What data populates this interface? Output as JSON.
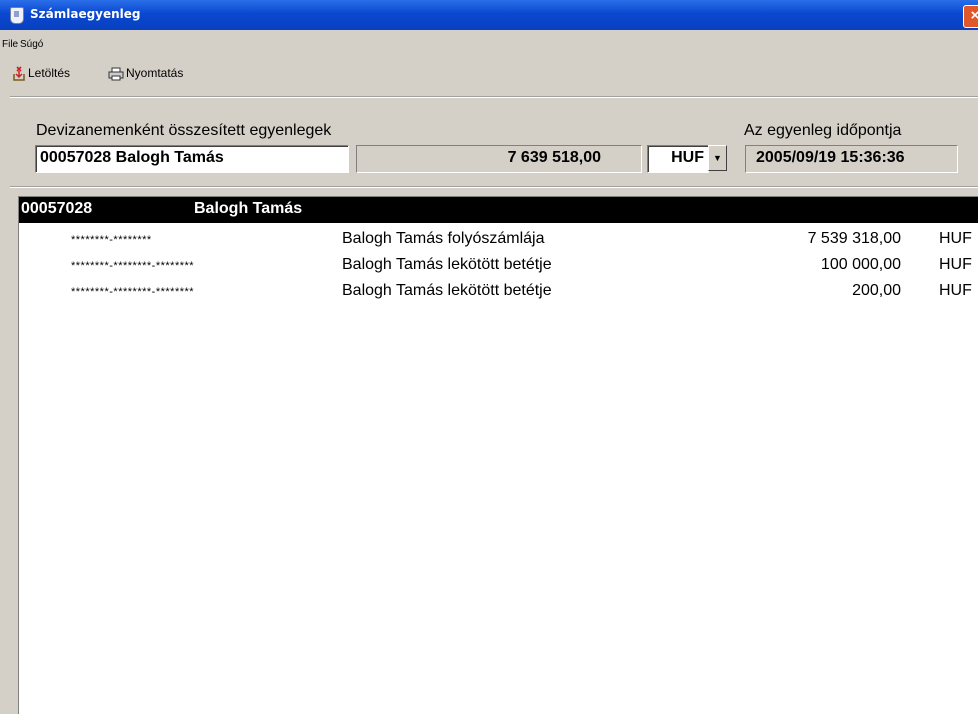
{
  "window": {
    "title": "Számlaegyenleg",
    "close_glyph": "×"
  },
  "menu": [
    "File",
    "Súgó"
  ],
  "toolbar": {
    "download_label": "Letöltés",
    "print_label": "Nyomtatás"
  },
  "summary": {
    "label": "Devizanemenként összesített egyenlegek",
    "client": "00057028 Balogh Tamás",
    "total": "7 639 518,00",
    "currency": "HUF",
    "date_label": "Az egyenleg időpontja",
    "date": "2005/09/19  15:36:36"
  },
  "list": {
    "header_id": "00057028",
    "header_name": "Balogh Tamás",
    "rows": [
      {
        "account": "********-********",
        "description": "Balogh Tamás folyószámlája",
        "amount": "7 539 318,00",
        "currency": "HUF"
      },
      {
        "account": "********-********-********",
        "description": "Balogh Tamás lekötött betétje",
        "amount": "100 000,00",
        "currency": "HUF"
      },
      {
        "account": "********-********-********",
        "description": "Balogh Tamás lekötött betétje",
        "amount": "200,00",
        "currency": "HUF"
      }
    ]
  },
  "icons": {
    "app": "document-icon",
    "close": "close-icon",
    "download": "download-icon",
    "print": "printer-icon",
    "dropdown": "dropdown-arrow-icon"
  }
}
